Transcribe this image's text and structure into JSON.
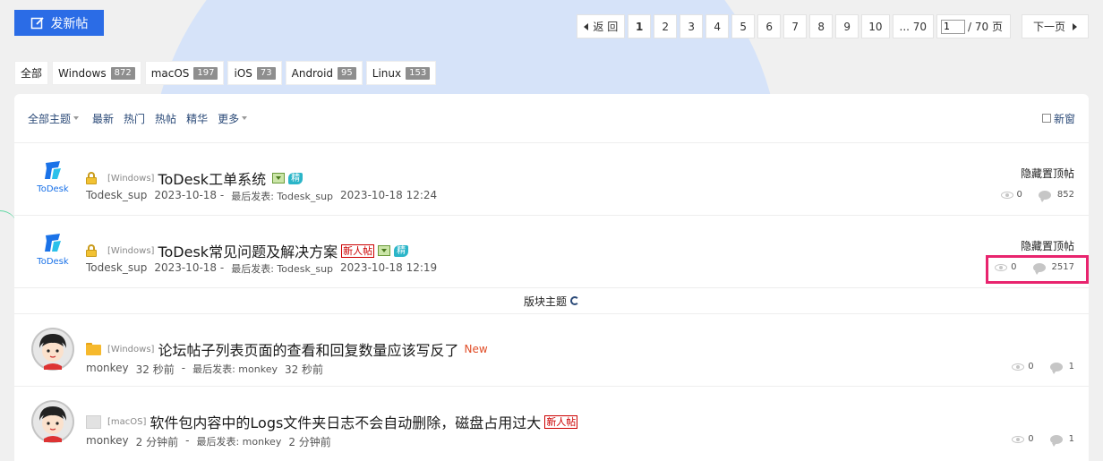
{
  "new_post_button": "发新帖",
  "pager": {
    "back": "返 回",
    "pages": [
      "1",
      "2",
      "3",
      "4",
      "5",
      "6",
      "7",
      "8",
      "9",
      "10"
    ],
    "ellipsis_last": "... 70",
    "input_value": "1",
    "total": "/ 70 页",
    "next": "下一页"
  },
  "categories": [
    {
      "label": "全部",
      "count": ""
    },
    {
      "label": "Windows",
      "count": "872"
    },
    {
      "label": "macOS",
      "count": "197"
    },
    {
      "label": "iOS",
      "count": "73"
    },
    {
      "label": "Android",
      "count": "95"
    },
    {
      "label": "Linux",
      "count": "153"
    }
  ],
  "toolbar": {
    "all_topics": "全部主题",
    "latest": "最新",
    "hot": "热门",
    "hot_posts": "热帖",
    "digest": "精华",
    "more": "更多",
    "new_window": "新窗"
  },
  "section_label": "版块主题",
  "threads": [
    {
      "tag": "[Windows]",
      "title": "ToDesk工单系统",
      "author": "Todesk_sup",
      "date": "2023-10-18 -",
      "last_label": "最后发表: Todesk_sup",
      "last_time": "2023-10-18 12:24",
      "right_label": "隐藏置顶帖",
      "views": "0",
      "replies": "852",
      "avatar_text": "ToDesk",
      "badge_jing": "精"
    },
    {
      "tag": "[Windows]",
      "title": "ToDesk常见问题及解决方案",
      "author": "Todesk_sup",
      "date": "2023-10-18 -",
      "last_label": "最后发表: Todesk_sup",
      "last_time": "2023-10-18 12:19",
      "right_label": "隐藏置顶帖",
      "views": "0",
      "replies": "2517",
      "avatar_text": "ToDesk",
      "badge_newbie": "新人帖",
      "badge_jing": "精"
    },
    {
      "tag": "[Windows]",
      "title": "论坛帖子列表页面的查看和回复数量应该写反了",
      "author": "monkey",
      "date": "32 秒前",
      "sep": "-",
      "last_label": "最后发表: monkey",
      "last_time": "32 秒前",
      "views": "0",
      "replies": "1",
      "new_label": "New"
    },
    {
      "tag": "[macOS]",
      "title": "软件包内容中的Logs文件夹日志不会自动删除，磁盘占用过大",
      "author": "monkey",
      "date": "2 分钟前",
      "sep": "-",
      "last_label": "最后发表: monkey",
      "last_time": "2 分钟前",
      "views": "0",
      "replies": "1",
      "badge_newbie": "新人帖"
    }
  ],
  "colors": {
    "accent": "#2b6ce6",
    "highlight": "#e8246e",
    "link": "#2b4a78"
  }
}
